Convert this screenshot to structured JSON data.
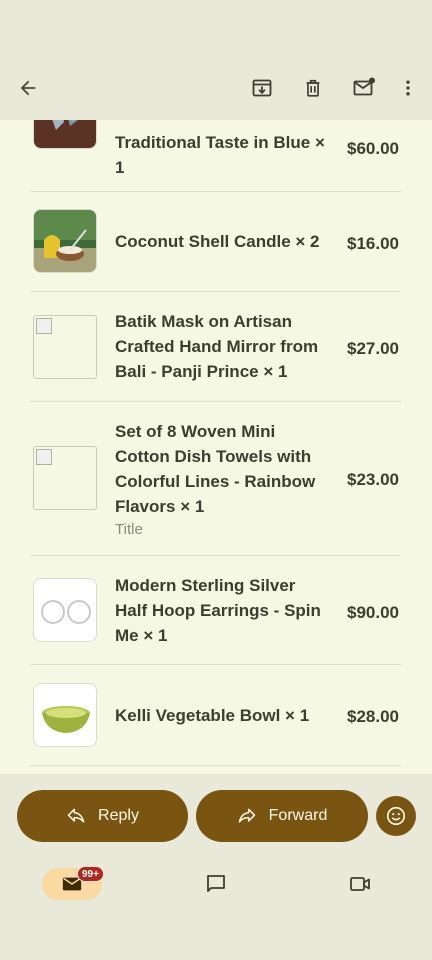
{
  "toolbar": {
    "back_icon": "arrow-back-icon",
    "archive_icon": "archive-icon",
    "delete_icon": "delete-icon",
    "mark_unread_icon": "mark-unread-icon",
    "more_icon": "more-vert-icon"
  },
  "items": [
    {
      "name": "Traditional Taste in Blue × 1",
      "price": "$60.00",
      "subtitle": ""
    },
    {
      "name": "Coconut Shell Candle × 2",
      "price": "$16.00",
      "subtitle": ""
    },
    {
      "name": "Batik Mask on Artisan Crafted Hand Mirror from Bali - Panji Prince × 1",
      "price": "$27.00",
      "subtitle": ""
    },
    {
      "name": "Set of 8 Woven Mini Cotton Dish Towels with Colorful Lines - Rainbow Flavors × 1",
      "price": "$23.00",
      "subtitle": "Title"
    },
    {
      "name": "Modern Sterling Silver Half Hoop Earrings - Spin Me × 1",
      "price": "$90.00",
      "subtitle": ""
    },
    {
      "name": "Kelli Vegetable Bowl × 1",
      "price": "$28.00",
      "subtitle": ""
    }
  ],
  "actions": {
    "reply_label": "Reply",
    "forward_label": "Forward",
    "emoji_icon": "add-reaction-icon"
  },
  "nav": {
    "mail_badge": "99+",
    "mail_icon": "mail-icon",
    "chat_icon": "chat-icon",
    "meet_icon": "video-icon"
  },
  "colors": {
    "accent": "#7a5512",
    "content_bg": "#f5f8e3",
    "chrome_bg": "#e8e9d8",
    "badge": "#b3261e"
  }
}
